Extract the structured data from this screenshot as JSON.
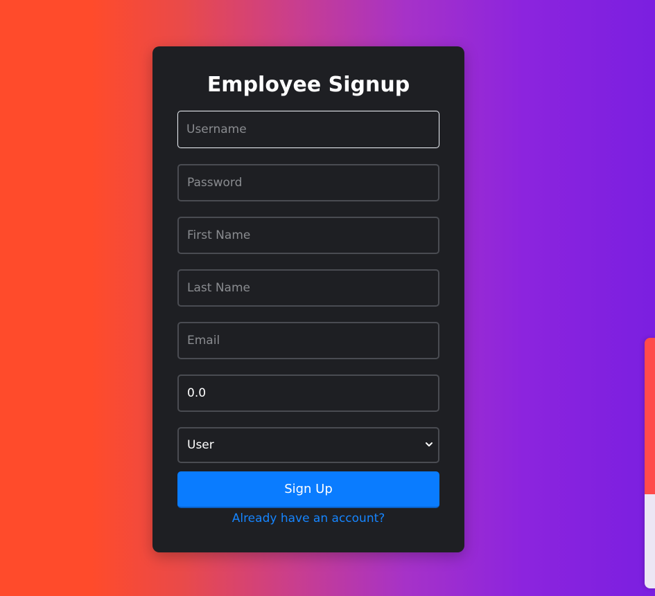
{
  "form": {
    "title": "Employee Signup",
    "username_placeholder": "Username",
    "password_placeholder": "Password",
    "first_name_placeholder": "First Name",
    "last_name_placeholder": "Last Name",
    "email_placeholder": "Email",
    "salary_value": "0.0",
    "role_options": [
      "User"
    ],
    "role_selected": "User",
    "signup_label": "Sign Up",
    "login_link_label": "Already have an account?"
  },
  "colors": {
    "card_bg": "#1e1f23",
    "accent": "#0a7cff",
    "link": "#1685ff",
    "gradient_start": "#ff4b2b",
    "gradient_end": "#7b1fe0"
  },
  "icons": {
    "role_select": "chevron-down-icon"
  }
}
